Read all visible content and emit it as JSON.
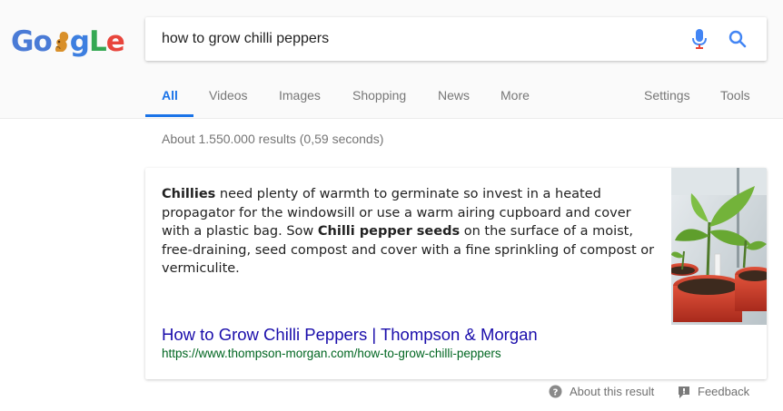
{
  "search": {
    "query": "how to grow chilli peppers"
  },
  "logo": {
    "parts": [
      "Go",
      "",
      "g",
      "L",
      "e"
    ]
  },
  "tabs": [
    {
      "label": "All"
    },
    {
      "label": "Videos"
    },
    {
      "label": "Images"
    },
    {
      "label": "Shopping"
    },
    {
      "label": "News"
    },
    {
      "label": "More"
    },
    {
      "label": "Settings"
    },
    {
      "label": "Tools"
    }
  ],
  "stats": "About 1.550.000 results (0,59 seconds)",
  "snippet": {
    "segments": [
      {
        "text": "Chillies",
        "bold": true
      },
      {
        "text": " need plenty of warmth to germinate so invest in a heated propagator for the windowsill or use a warm airing cupboard and cover with a plastic bag. Sow ",
        "bold": false
      },
      {
        "text": "Chilli pepper seeds",
        "bold": true
      },
      {
        "text": " on the surface of a moist, free-draining, seed compost and cover with a fine sprinkling of compost or vermiculite.",
        "bold": false
      }
    ],
    "title": "How to Grow Chilli Peppers | Thompson & Morgan",
    "url": "https://www.thompson-morgan.com/how-to-grow-chilli-peppers"
  },
  "footer": {
    "about": "About this result",
    "feedback": "Feedback"
  },
  "colors": {
    "accent": "#1a73e8",
    "link": "#1a0dab",
    "url": "#006621",
    "mic_blue": "#4285f4",
    "mic_red": "#ea4335"
  },
  "icons": [
    "squirrel-doodle-icon",
    "microphone-icon",
    "search-icon",
    "help-circle-icon",
    "feedback-flag-icon"
  ]
}
